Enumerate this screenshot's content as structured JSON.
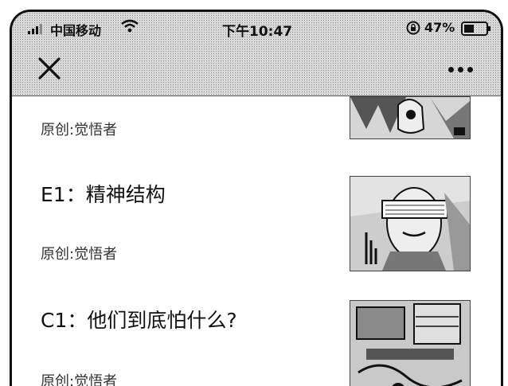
{
  "status_bar": {
    "carrier": "中国移动",
    "time": "下午10:47",
    "battery_percent": "47%",
    "battery_level": 0.47,
    "icons": [
      "signal-icon",
      "wifi-icon",
      "orientation-lock-icon",
      "battery-icon"
    ]
  },
  "nav": {
    "close_icon": "close-icon",
    "more_icon": "more-icon"
  },
  "articles": [
    {
      "title": "",
      "author": "原创:觉悟者",
      "thumb": "partial-illustration"
    },
    {
      "title": "E1：精神结构",
      "author": "原创:觉悟者",
      "thumb": "blindfolded-face-illustration"
    },
    {
      "title": "C1：他们到底怕什么?",
      "author": "原创:觉悟者",
      "thumb": "scene-illustration"
    }
  ]
}
